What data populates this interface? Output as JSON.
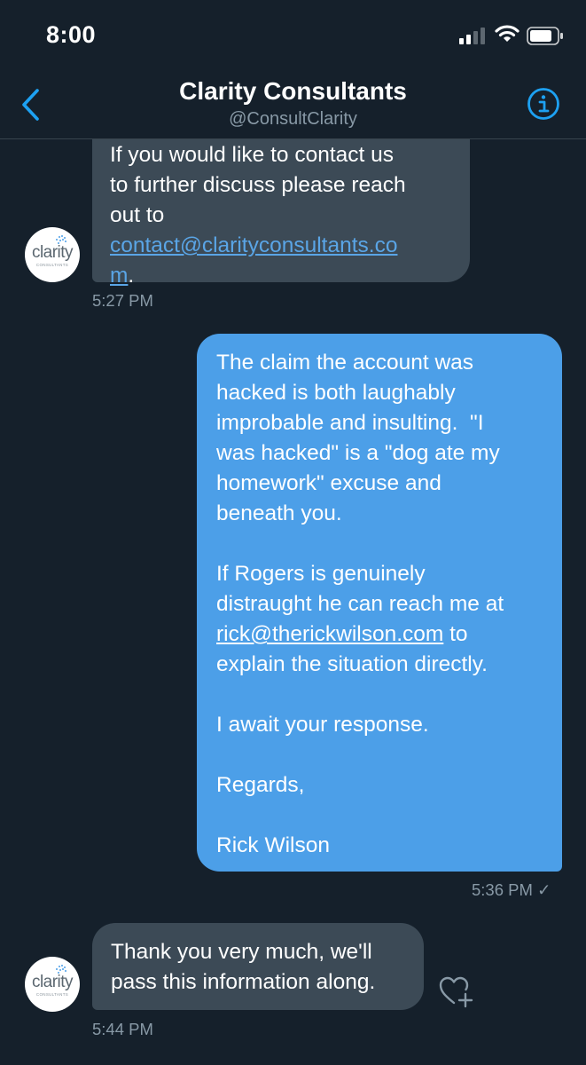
{
  "status_bar": {
    "time": "8:00",
    "icons": [
      "signal-icon",
      "wifi-icon",
      "battery-icon"
    ]
  },
  "header": {
    "title": "Clarity Consultants",
    "handle": "@ConsultClarity",
    "icons": [
      "back-chevron-icon",
      "info-icon"
    ]
  },
  "avatar": {
    "logo_text": "clarity",
    "logo_subtext": "CONSULTANTS"
  },
  "messages": [
    {
      "direction": "incoming",
      "lines": [
        "If you would like to contact us",
        "to further discuss please reach",
        "out to"
      ],
      "link_lines": [
        "contact@clarityconsultants.co",
        "m"
      ],
      "trailing": ".",
      "time": "5:27 PM"
    },
    {
      "direction": "outgoing",
      "paragraphs": [
        "The claim the account was\nhacked is both laughably\nimprobable and insulting.  \"I\nwas hacked\" is a \"dog ate my\nhomework\" excuse and\nbeneath you.",
        "If Rogers is genuinely\ndistraught he can reach me at"
      ],
      "link": "rick@therickwilson.com",
      "link_after": " to",
      "after_link_line": "explain the situation directly.",
      "closing": [
        "I await your response.",
        "Regards,",
        "Rick Wilson"
      ],
      "time": "5:36 PM",
      "read_mark": "✓"
    },
    {
      "direction": "incoming",
      "text": "Thank you very much, we'll\npass this information along.",
      "time": "5:44 PM"
    }
  ],
  "colors": {
    "background": "#15202b",
    "incoming_bubble": "#3c4a56",
    "outgoing_bubble": "#4c9fe8",
    "accent": "#1da1f2",
    "muted_text": "#8899a6"
  }
}
